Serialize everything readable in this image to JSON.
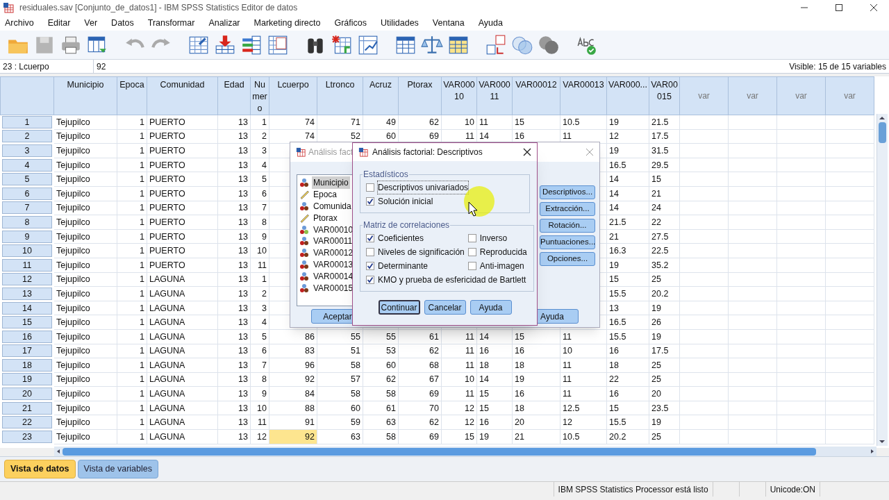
{
  "window": {
    "title": "residuales.sav [Conjunto_de_datos1] - IBM SPSS Statistics Editor de datos"
  },
  "menu": [
    "Archivo",
    "Editar",
    "Ver",
    "Datos",
    "Transformar",
    "Analizar",
    "Marketing directo",
    "Gráficos",
    "Utilidades",
    "Ventana",
    "Ayuda"
  ],
  "cell_editor": {
    "reference": "23 : Lcuerpo",
    "value": "92",
    "visible": "Visible: 15 de 15 variables"
  },
  "table": {
    "columns": [
      {
        "label": "Municipio",
        "kind": "string",
        "selected": false
      },
      {
        "label": "Epoca",
        "kind": "numeric",
        "selected": false
      },
      {
        "label": "Comunidad",
        "kind": "string",
        "selected": false
      },
      {
        "label": "Edad",
        "kind": "numeric",
        "selected": false
      },
      {
        "label": "Numero",
        "kind": "numeric",
        "selected": false
      },
      {
        "label": "Lcuerpo",
        "kind": "numeric",
        "selected": true
      },
      {
        "label": "Ltronco",
        "kind": "numeric",
        "selected": false
      },
      {
        "label": "Acruz",
        "kind": "numeric",
        "selected": false
      },
      {
        "label": "Ptorax",
        "kind": "numeric",
        "selected": false
      },
      {
        "label": "VAR00010",
        "kind": "numeric",
        "selected": false
      },
      {
        "label": "VAR00011",
        "kind": "string",
        "selected": false
      },
      {
        "label": "VAR00012",
        "kind": "string",
        "selected": false
      },
      {
        "label": "VAR00013",
        "kind": "string",
        "selected": false
      },
      {
        "label": "VAR000...",
        "kind": "string",
        "selected": false
      },
      {
        "label": "VAR00015",
        "kind": "string",
        "selected": false
      },
      {
        "label": "var",
        "kind": "empty",
        "selected": false
      },
      {
        "label": "var",
        "kind": "empty",
        "selected": false
      },
      {
        "label": "var",
        "kind": "empty",
        "selected": false
      },
      {
        "label": "var",
        "kind": "empty",
        "selected": false
      }
    ],
    "rows": [
      {
        "number": "1",
        "selected": false,
        "cells": [
          "Tejupilco",
          "1",
          "PUERTO",
          "13",
          "1",
          "74",
          "71",
          "49",
          "62",
          "10",
          "11",
          "15",
          "10.5",
          "19",
          "21.5"
        ]
      },
      {
        "number": "2",
        "selected": false,
        "cells": [
          "Tejupilco",
          "1",
          "PUERTO",
          "13",
          "2",
          "74",
          "52",
          "60",
          "69",
          "11",
          "14",
          "16",
          "11",
          "12",
          "17.5"
        ]
      },
      {
        "number": "3",
        "selected": false,
        "cells": [
          "Tejupilco",
          "1",
          "PUERTO",
          "13",
          "3",
          null,
          null,
          null,
          null,
          null,
          null,
          null,
          null,
          "19",
          "31.5"
        ]
      },
      {
        "number": "4",
        "selected": false,
        "cells": [
          "Tejupilco",
          "1",
          "PUERTO",
          "13",
          "4",
          null,
          null,
          null,
          null,
          null,
          null,
          null,
          null,
          "16.5",
          "29.5"
        ]
      },
      {
        "number": "5",
        "selected": false,
        "cells": [
          "Tejupilco",
          "1",
          "PUERTO",
          "13",
          "5",
          null,
          null,
          null,
          null,
          null,
          null,
          null,
          null,
          "14",
          "15"
        ]
      },
      {
        "number": "6",
        "selected": false,
        "cells": [
          "Tejupilco",
          "1",
          "PUERTO",
          "13",
          "6",
          null,
          null,
          null,
          null,
          null,
          null,
          null,
          null,
          "14",
          "21"
        ]
      },
      {
        "number": "7",
        "selected": false,
        "cells": [
          "Tejupilco",
          "1",
          "PUERTO",
          "13",
          "7",
          null,
          null,
          null,
          null,
          null,
          null,
          null,
          null,
          "14",
          "24"
        ]
      },
      {
        "number": "8",
        "selected": false,
        "cells": [
          "Tejupilco",
          "1",
          "PUERTO",
          "13",
          "8",
          null,
          null,
          null,
          null,
          null,
          null,
          null,
          null,
          "21.5",
          "22"
        ]
      },
      {
        "number": "9",
        "selected": false,
        "cells": [
          "Tejupilco",
          "1",
          "PUERTO",
          "13",
          "9",
          null,
          null,
          null,
          null,
          null,
          null,
          null,
          null,
          "21",
          "27.5"
        ]
      },
      {
        "number": "10",
        "selected": false,
        "cells": [
          "Tejupilco",
          "1",
          "PUERTO",
          "13",
          "10",
          null,
          null,
          null,
          null,
          null,
          null,
          null,
          null,
          "16.3",
          "22.5"
        ]
      },
      {
        "number": "11",
        "selected": false,
        "cells": [
          "Tejupilco",
          "1",
          "PUERTO",
          "13",
          "11",
          null,
          null,
          null,
          null,
          null,
          null,
          null,
          null,
          "19",
          "35.2"
        ]
      },
      {
        "number": "12",
        "selected": false,
        "cells": [
          "Tejupilco",
          "1",
          "LAGUNA",
          "13",
          "1",
          null,
          null,
          null,
          null,
          null,
          null,
          null,
          null,
          "15",
          "25"
        ]
      },
      {
        "number": "13",
        "selected": false,
        "cells": [
          "Tejupilco",
          "1",
          "LAGUNA",
          "13",
          "2",
          null,
          null,
          null,
          null,
          null,
          null,
          null,
          null,
          "15.5",
          "20.2"
        ]
      },
      {
        "number": "14",
        "selected": false,
        "cells": [
          "Tejupilco",
          "1",
          "LAGUNA",
          "13",
          "3",
          null,
          null,
          null,
          null,
          null,
          null,
          null,
          null,
          "13",
          "19"
        ]
      },
      {
        "number": "15",
        "selected": false,
        "cells": [
          "Tejupilco",
          "1",
          "LAGUNA",
          "13",
          "4",
          null,
          null,
          null,
          null,
          null,
          null,
          null,
          null,
          "16.5",
          "26"
        ]
      },
      {
        "number": "16",
        "selected": false,
        "cells": [
          "Tejupilco",
          "1",
          "LAGUNA",
          "13",
          "5",
          "86",
          "55",
          "55",
          "61",
          "11",
          "14",
          "15",
          "11",
          "15.5",
          "19"
        ]
      },
      {
        "number": "17",
        "selected": false,
        "cells": [
          "Tejupilco",
          "1",
          "LAGUNA",
          "13",
          "6",
          "83",
          "51",
          "53",
          "62",
          "11",
          "16",
          "16",
          "10",
          "16",
          "17.5"
        ]
      },
      {
        "number": "18",
        "selected": false,
        "cells": [
          "Tejupilco",
          "1",
          "LAGUNA",
          "13",
          "7",
          "96",
          "58",
          "60",
          "68",
          "11",
          "18",
          "18",
          "11",
          "18",
          "25"
        ]
      },
      {
        "number": "19",
        "selected": false,
        "cells": [
          "Tejupilco",
          "1",
          "LAGUNA",
          "13",
          "8",
          "92",
          "57",
          "62",
          "67",
          "10",
          "14",
          "19",
          "11",
          "22",
          "25"
        ]
      },
      {
        "number": "20",
        "selected": false,
        "cells": [
          "Tejupilco",
          "1",
          "LAGUNA",
          "13",
          "9",
          "84",
          "58",
          "58",
          "69",
          "11",
          "15",
          "16",
          "11",
          "16",
          "20"
        ]
      },
      {
        "number": "21",
        "selected": false,
        "cells": [
          "Tejupilco",
          "1",
          "LAGUNA",
          "13",
          "10",
          "88",
          "60",
          "61",
          "70",
          "12",
          "15",
          "18",
          "12.5",
          "15",
          "23.5"
        ]
      },
      {
        "number": "22",
        "selected": false,
        "cells": [
          "Tejupilco",
          "1",
          "LAGUNA",
          "13",
          "11",
          "91",
          "59",
          "63",
          "62",
          "12",
          "16",
          "20",
          "12",
          "15.5",
          "19"
        ]
      },
      {
        "number": "23",
        "selected": true,
        "cells": [
          "Tejupilco",
          "1",
          "LAGUNA",
          "13",
          "12",
          "92",
          "63",
          "58",
          "69",
          "15",
          "19",
          "21",
          "10.5",
          "20.2",
          "25"
        ]
      }
    ]
  },
  "dialog": {
    "title": "Análisis fact",
    "variables": [
      {
        "name": "Municipio",
        "kind": "nominal",
        "selected": true
      },
      {
        "name": "Epoca",
        "kind": "scale",
        "selected": false
      },
      {
        "name": "Comunida",
        "kind": "nominal",
        "selected": false
      },
      {
        "name": "Ptorax",
        "kind": "scale",
        "selected": false
      },
      {
        "name": "VAR00010",
        "kind": "numeric_nominal",
        "selected": false
      },
      {
        "name": "VAR00011",
        "kind": "nominal",
        "selected": false
      },
      {
        "name": "VAR00012",
        "kind": "nominal",
        "selected": false
      },
      {
        "name": "VAR00013",
        "kind": "nominal",
        "selected": false
      },
      {
        "name": "VAR00014",
        "kind": "nominal",
        "selected": false
      },
      {
        "name": "VAR00015",
        "kind": "nominal",
        "selected": false
      }
    ],
    "buttons": [
      "Descriptivos...",
      "Extracción...",
      "Rotación...",
      "Puntuaciones...",
      "Opciones..."
    ],
    "footer_buttons": [
      "Aceptar",
      "Ayuda"
    ]
  },
  "subdialog": {
    "title": "Análisis factorial: Descriptivos",
    "groups": [
      {
        "title": "Estadísticos",
        "options": [
          {
            "label": "Descriptivos univariados",
            "checked": false,
            "focused": true
          },
          {
            "label": "Solución inicial",
            "checked": true,
            "focused": false
          }
        ]
      },
      {
        "title": "Matriz de correlaciones",
        "options": [
          {
            "label": "Coeficientes",
            "checked": true,
            "focused": false
          },
          {
            "label": "Inverso",
            "checked": false,
            "focused": false
          },
          {
            "label": "Niveles de significación",
            "checked": false,
            "focused": false
          },
          {
            "label": "Reproducida",
            "checked": false,
            "focused": false
          },
          {
            "label": "Determinante",
            "checked": true,
            "focused": false
          },
          {
            "label": "Anti-imagen",
            "checked": false,
            "focused": false
          },
          {
            "label": "KMO y prueba de esfericidad de Bartlett",
            "checked": true,
            "focused": false
          }
        ]
      }
    ],
    "buttons": [
      "Continuar",
      "Cancelar",
      "Ayuda"
    ]
  },
  "view_tabs": [
    {
      "label": "Vista de datos",
      "selected": true
    },
    {
      "label": "Vista de variables",
      "selected": false
    }
  ],
  "status_bar": [
    "IBM SPSS Statistics Processor está listo",
    "Unicode:ON"
  ]
}
